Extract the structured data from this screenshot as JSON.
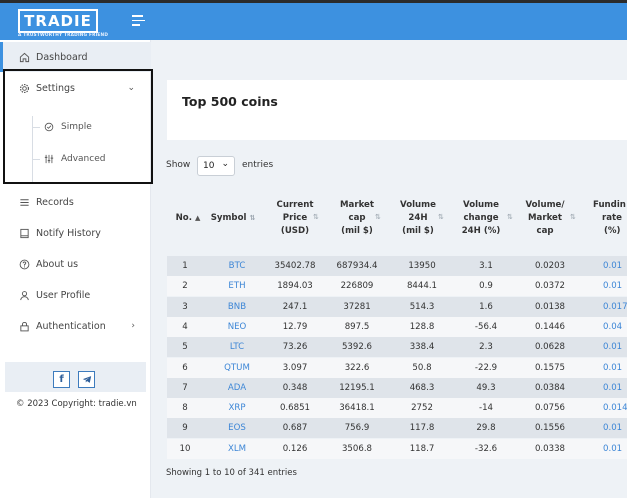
{
  "header": {
    "logo": "TRADIE",
    "tagline": "A TRUSTWORTHY TRADING FRIEND"
  },
  "sidebar": {
    "items": [
      {
        "label": "Dashboard",
        "icon": "home-icon"
      },
      {
        "label": "Settings",
        "icon": "gear-icon"
      },
      {
        "label": "Records",
        "icon": "list-icon"
      },
      {
        "label": "Notify History",
        "icon": "book-icon"
      },
      {
        "label": "About us",
        "icon": "question-circle-icon"
      },
      {
        "label": "User Profile",
        "icon": "user-icon"
      },
      {
        "label": "Authentication",
        "icon": "lock-icon"
      }
    ],
    "submenu": [
      {
        "label": "Simple",
        "icon": "check-circle-icon"
      },
      {
        "label": "Advanced",
        "icon": "sliders-icon"
      }
    ],
    "social": {
      "facebook": "f",
      "telegram": "telegram-icon"
    },
    "copyright": "© 2023 Copyright: tradie.vn"
  },
  "main": {
    "title": "Top 500 coins",
    "show_label": "Show",
    "entries_value": "10",
    "entries_label": "entries",
    "columns": [
      {
        "line1": "No.",
        "line2": "",
        "line3": ""
      },
      {
        "line1": "Symbol",
        "line2": "",
        "line3": ""
      },
      {
        "line1": "Current",
        "line2": "Price",
        "line3": "(USD)"
      },
      {
        "line1": "Market",
        "line2": "cap",
        "line3": "(mil $)"
      },
      {
        "line1": "Volume",
        "line2": "24H",
        "line3": "(mil $)"
      },
      {
        "line1": "Volume",
        "line2": "change",
        "line3": "24H (%)"
      },
      {
        "line1": "Volume/",
        "line2": "Market",
        "line3": "cap"
      },
      {
        "line1": "Fundin",
        "line2": "rate",
        "line3": "(%)"
      }
    ],
    "rows": [
      [
        "1",
        "BTC",
        "35402.78",
        "687934.4",
        "13950",
        "3.1",
        "0.0203",
        "0.01"
      ],
      [
        "2",
        "ETH",
        "1894.03",
        "226809",
        "8444.1",
        "0.9",
        "0.0372",
        "0.01"
      ],
      [
        "3",
        "BNB",
        "247.1",
        "37281",
        "514.3",
        "1.6",
        "0.0138",
        "0.017"
      ],
      [
        "4",
        "NEO",
        "12.79",
        "897.5",
        "128.8",
        "-56.4",
        "0.1446",
        "0.04"
      ],
      [
        "5",
        "LTC",
        "73.26",
        "5392.6",
        "338.4",
        "2.3",
        "0.0628",
        "0.01"
      ],
      [
        "6",
        "QTUM",
        "3.097",
        "322.6",
        "50.8",
        "-22.9",
        "0.1575",
        "0.01"
      ],
      [
        "7",
        "ADA",
        "0.348",
        "12195.1",
        "468.3",
        "49.3",
        "0.0384",
        "0.01"
      ],
      [
        "8",
        "XRP",
        "0.6851",
        "36418.1",
        "2752",
        "-14",
        "0.0756",
        "0.014"
      ],
      [
        "9",
        "EOS",
        "0.687",
        "756.9",
        "117.8",
        "29.8",
        "0.1556",
        "0.01"
      ],
      [
        "10",
        "XLM",
        "0.126",
        "3506.8",
        "118.7",
        "-32.6",
        "0.0338",
        "0.01"
      ]
    ],
    "showing": "Showing 1 to 10 of 341 entries"
  }
}
